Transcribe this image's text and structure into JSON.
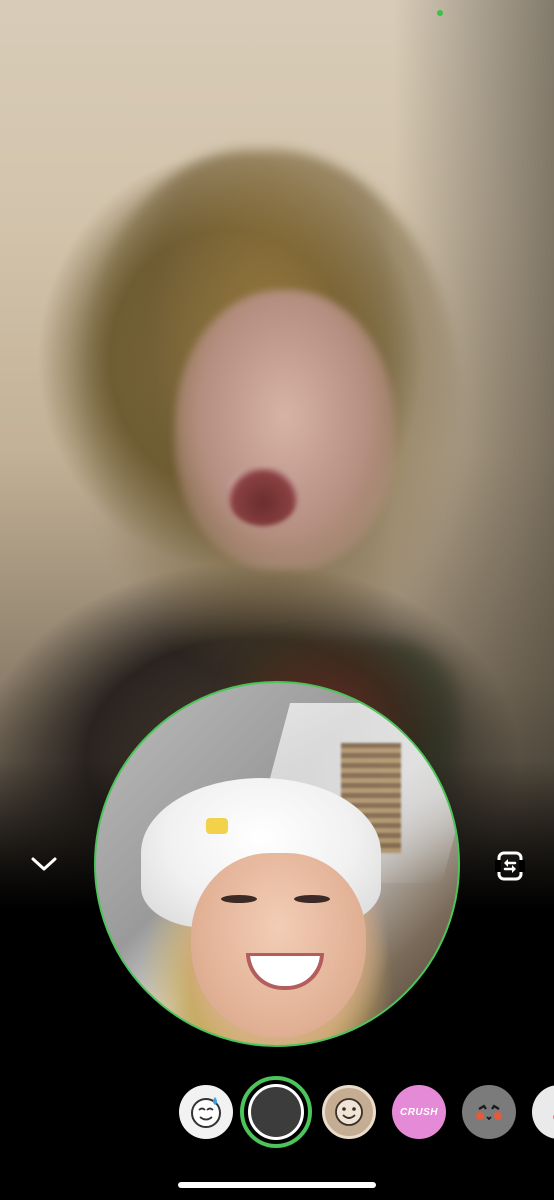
{
  "app": {
    "status": {
      "indicator_color": "#39c24a"
    },
    "accent_color": "#4cc45a"
  },
  "controls": {
    "collapse_icon": "chevron-down-icon",
    "flip_camera_icon": "flip-camera-icon"
  },
  "filters": [
    {
      "icon": "face-sticker-icon"
    },
    {
      "icon": "capture-button"
    },
    {
      "icon": "smiley-face-icon"
    },
    {
      "icon": "crush-filter",
      "label": "CRUSH"
    },
    {
      "icon": "blush-face-icon"
    },
    {
      "icon": "partial-filter-icon"
    }
  ]
}
